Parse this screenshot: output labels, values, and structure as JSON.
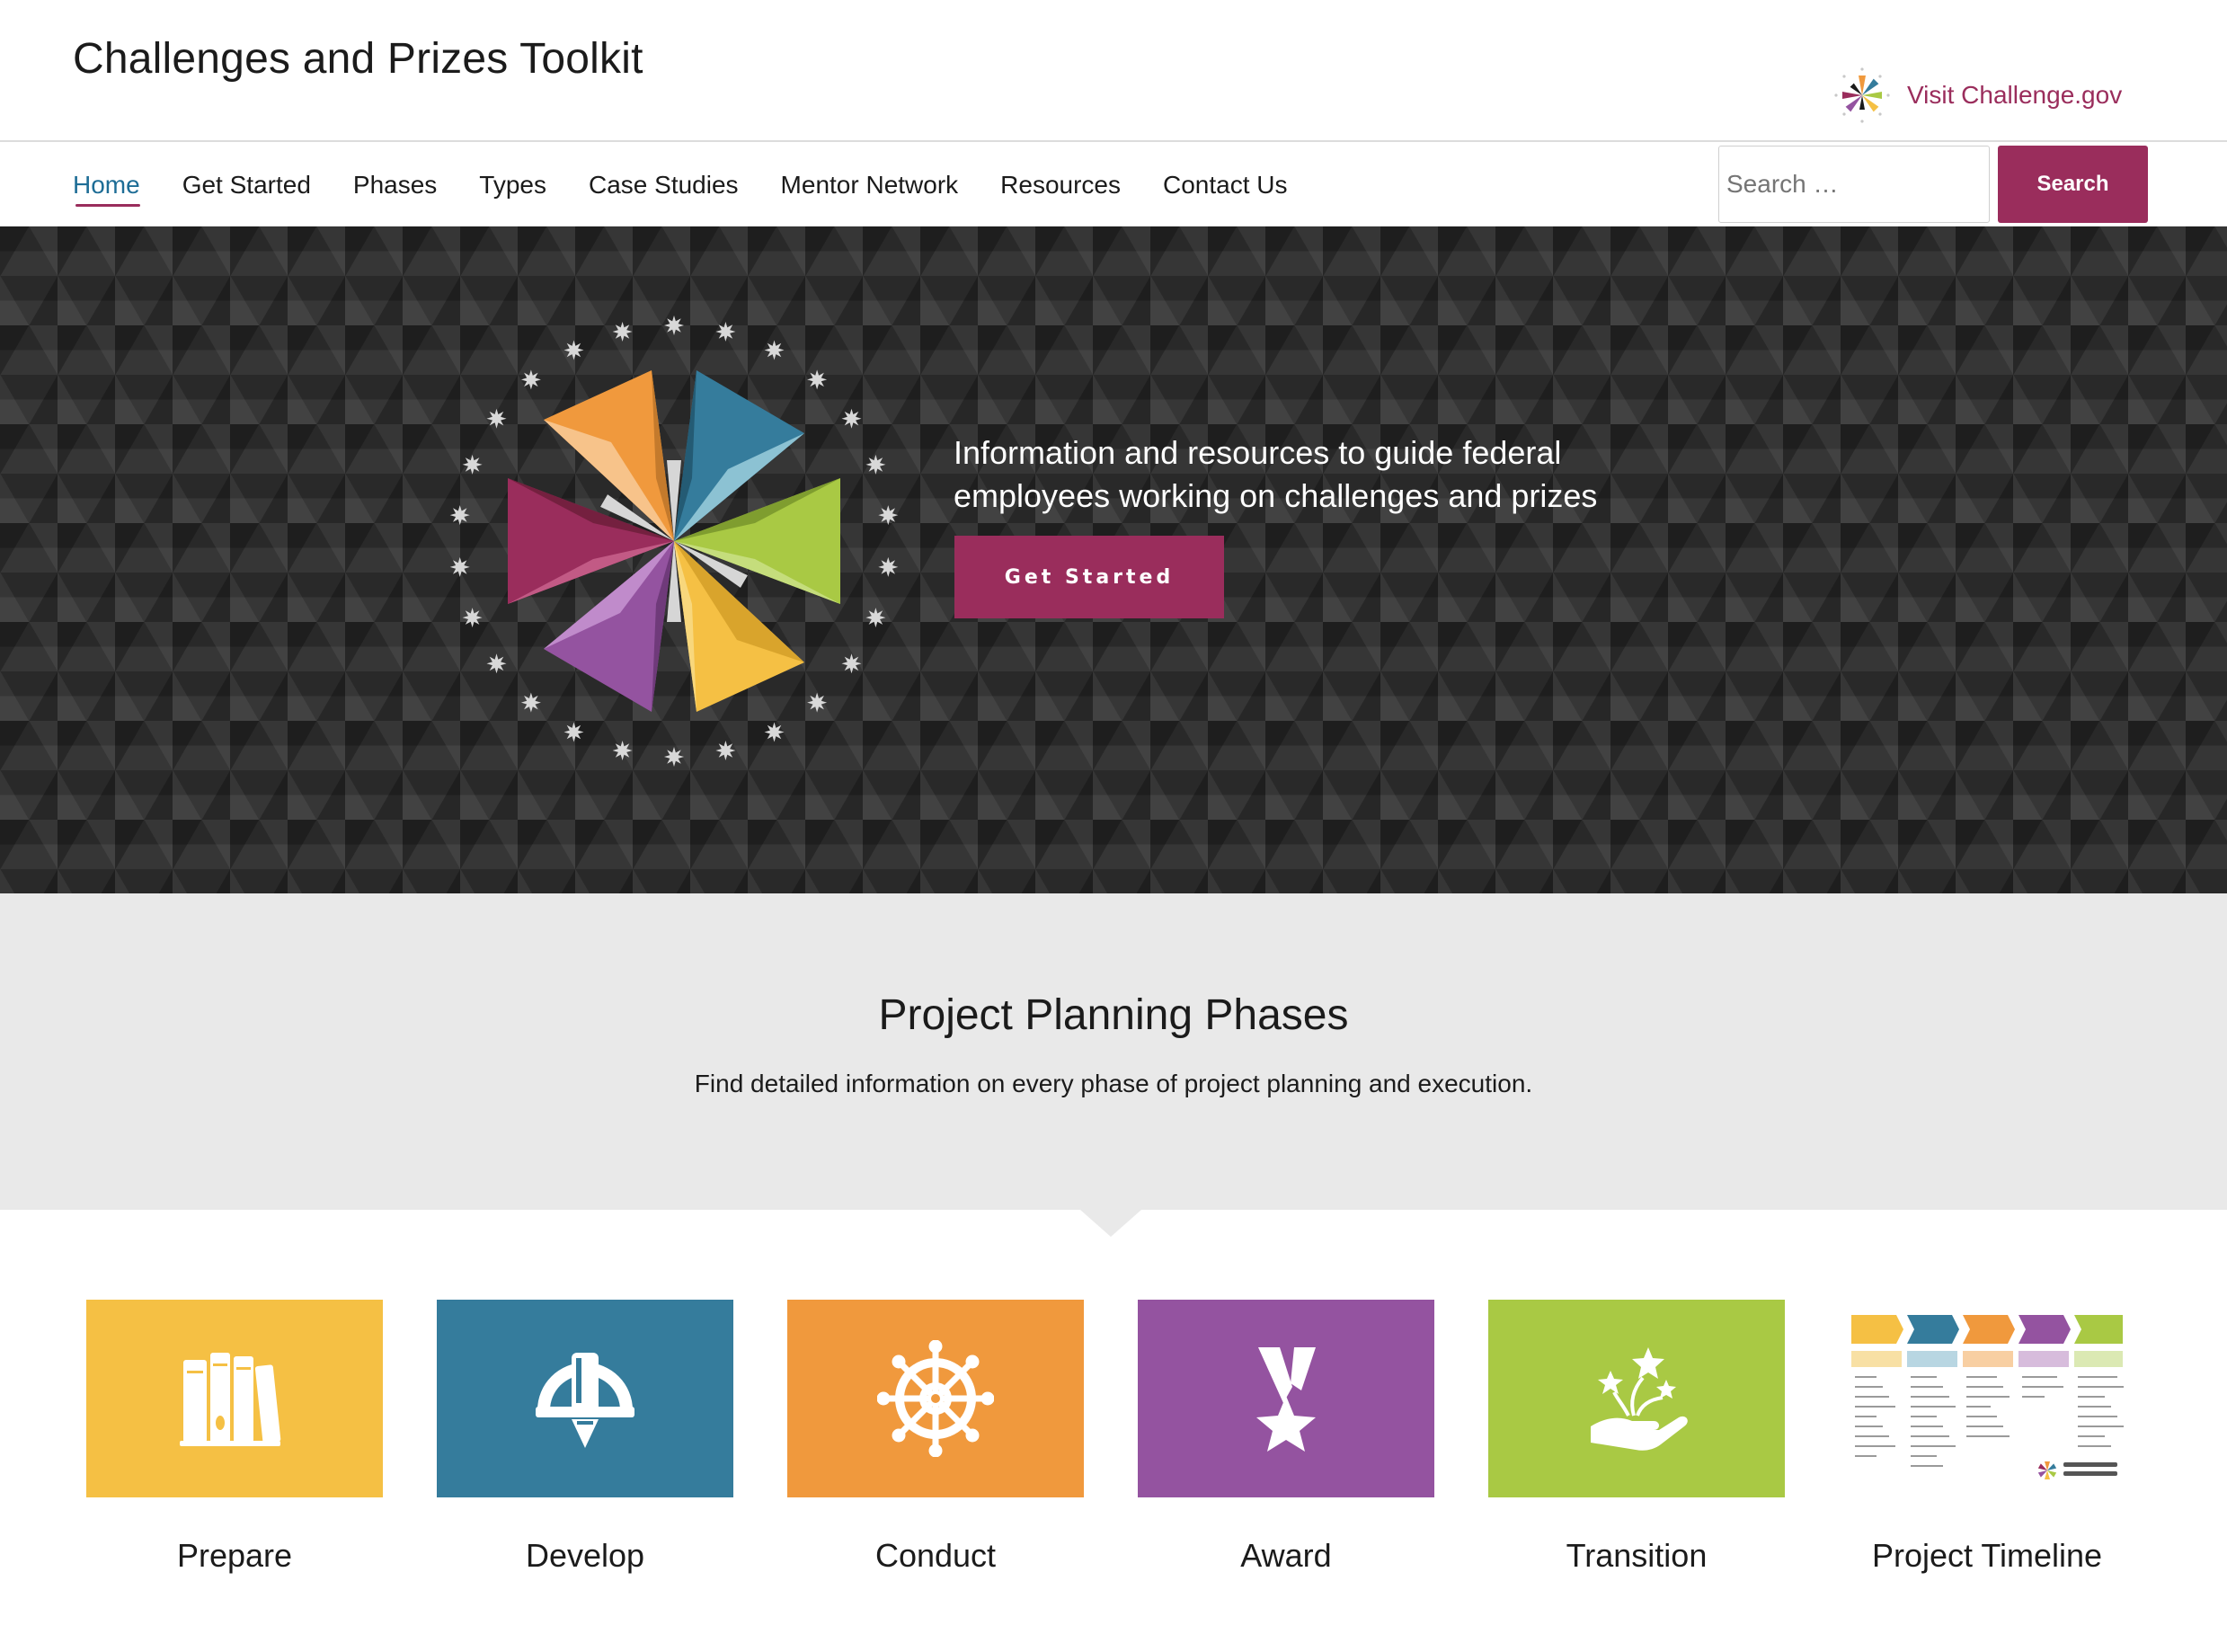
{
  "header": {
    "site_title": "Challenges and Prizes Toolkit",
    "visit_link": "Visit Challenge.gov"
  },
  "nav": {
    "items": [
      {
        "label": "Home",
        "active": true
      },
      {
        "label": "Get Started",
        "active": false
      },
      {
        "label": "Phases",
        "active": false
      },
      {
        "label": "Types",
        "active": false
      },
      {
        "label": "Case Studies",
        "active": false
      },
      {
        "label": "Mentor Network",
        "active": false
      },
      {
        "label": "Resources",
        "active": false
      },
      {
        "label": "Contact Us",
        "active": false
      }
    ],
    "search_placeholder": "Search …",
    "search_button": "Search"
  },
  "hero": {
    "tagline": "Information and resources to guide federal employees working on challenges and prizes",
    "button_label": "Get Started"
  },
  "phases": {
    "heading": "Project Planning Phases",
    "subheading": "Find detailed information on every phase of project planning and execution.",
    "cards": [
      {
        "label": "Prepare",
        "color": "#f5c044",
        "icon": "books-icon"
      },
      {
        "label": "Develop",
        "color": "#357c9c",
        "icon": "compass-pen-icon"
      },
      {
        "label": "Conduct",
        "color": "#f0993d",
        "icon": "ship-wheel-icon"
      },
      {
        "label": "Award",
        "color": "#9453a0",
        "icon": "medal-icon"
      },
      {
        "label": "Transition",
        "color": "#a9c944",
        "icon": "hand-stars-icon"
      },
      {
        "label": "Project Timeline",
        "color": "#ffffff",
        "icon": "timeline-thumbnail-icon"
      }
    ]
  },
  "colors": {
    "brand": "#9a2d5c",
    "nav_active": "#1e6d96",
    "hero_bg": "#2f2f2f",
    "section_bg": "#e9e9e9"
  }
}
